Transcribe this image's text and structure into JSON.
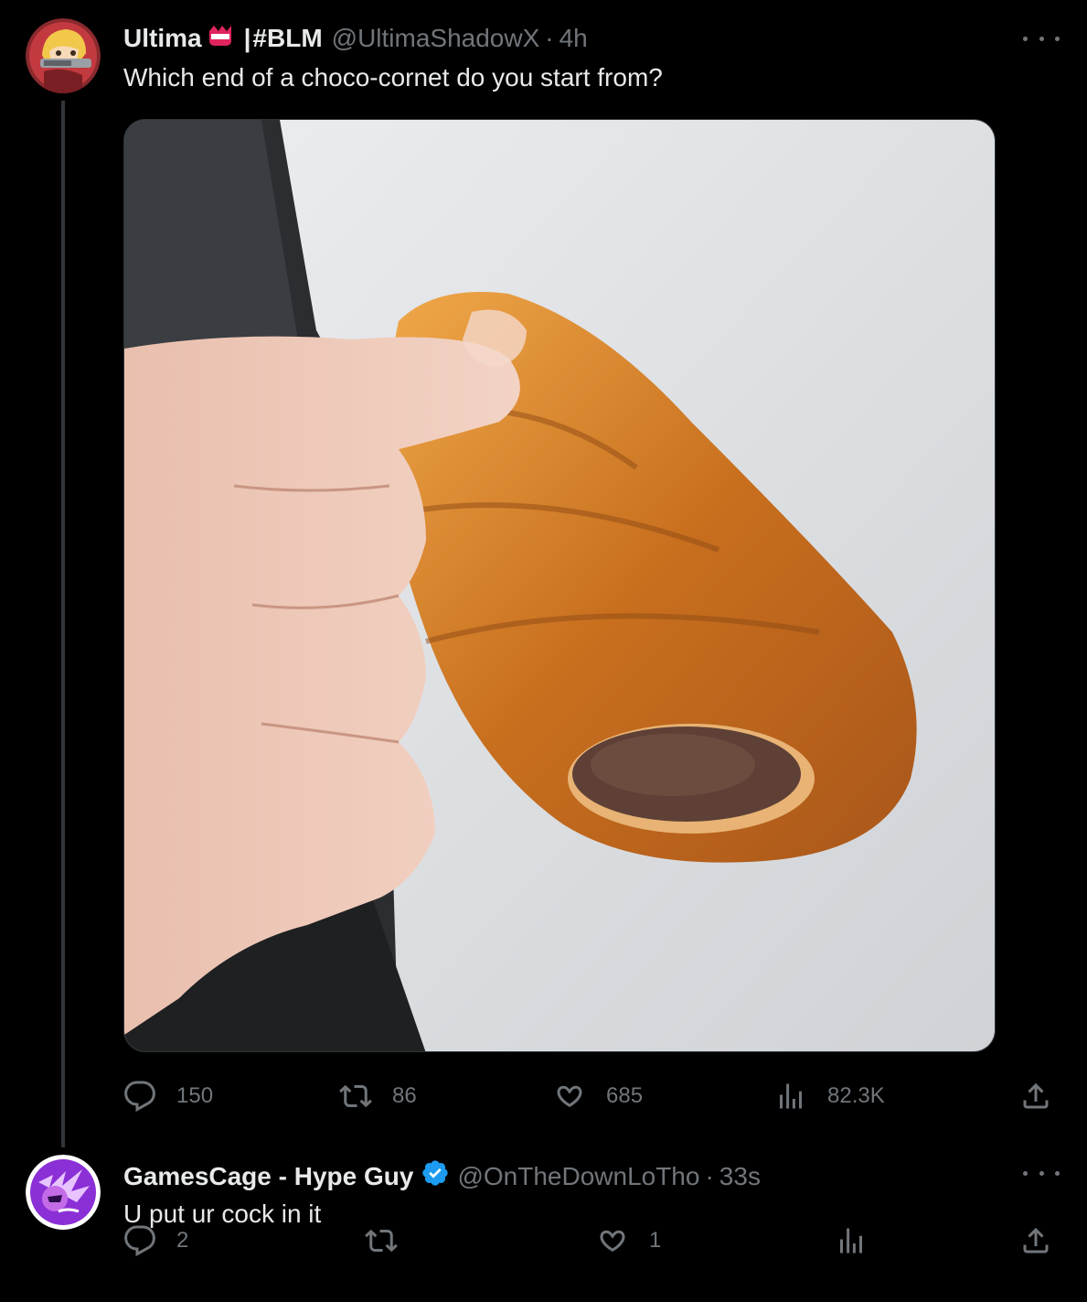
{
  "tweets": [
    {
      "display_name": "Ultima",
      "separator": "|",
      "hashtag": "#BLM",
      "handle": "@UltimaShadowX",
      "dot": "·",
      "time": "4h",
      "text": "Which end of a choco-cornet do you start from?",
      "has_media": true,
      "verified": false,
      "stats": {
        "replies": "150",
        "reposts": "86",
        "likes": "685",
        "views": "82.3K"
      }
    },
    {
      "display_name": "GamesCage - Hype Guy",
      "handle": "@OnTheDownLoTho",
      "dot": "·",
      "time": "33s",
      "text": "U put ur cock in it",
      "has_media": false,
      "verified": true,
      "stats": {
        "replies": "2",
        "reposts": "",
        "likes": "1",
        "views": ""
      }
    }
  ],
  "colors": {
    "background": "#000000",
    "primary_text": "#e7e9ea",
    "secondary_text": "#71767b",
    "verified_blue": "#1d9bf0",
    "thread_line": "#333639"
  },
  "icons": {
    "reply": "reply-icon",
    "repost": "repost-icon",
    "like": "heart-icon",
    "views": "views-icon",
    "share": "share-icon",
    "more": "more-icon",
    "verified": "verified-icon"
  }
}
